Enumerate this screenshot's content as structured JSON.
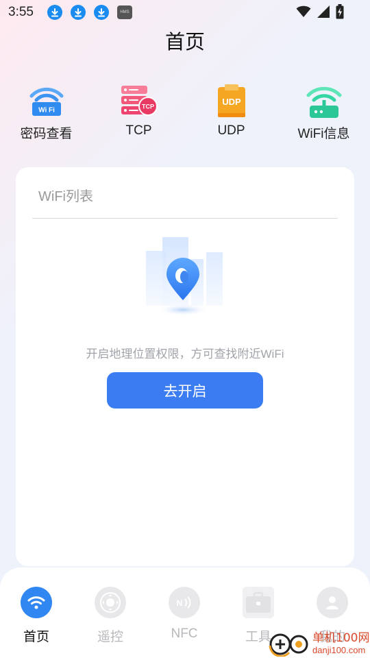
{
  "status_bar": {
    "time": "3:55",
    "hms_label": "HMS"
  },
  "page": {
    "title": "首页"
  },
  "shortcuts": [
    {
      "label": "密码查看",
      "icon": "wifi-password-icon",
      "badge": "Wi Fi"
    },
    {
      "label": "TCP",
      "icon": "tcp-server-icon",
      "badge": "TCP"
    },
    {
      "label": "UDP",
      "icon": "udp-clipboard-icon",
      "badge": "UDP"
    },
    {
      "label": "WiFi信息",
      "icon": "router-icon",
      "badge": ""
    }
  ],
  "wifi_card": {
    "header": "WiFi列表",
    "empty_message": "开启地理位置权限，方可查找附近WiFi",
    "button_label": "去开启"
  },
  "bottom_nav": {
    "items": [
      {
        "label": "首页",
        "icon": "wifi-icon",
        "active": true
      },
      {
        "label": "遥控",
        "icon": "remote-control-icon",
        "active": false
      },
      {
        "label": "NFC",
        "icon": "nfc-icon",
        "active": false
      },
      {
        "label": "工具",
        "icon": "toolbox-icon",
        "active": false
      },
      {
        "label": "我的",
        "icon": "user-icon",
        "active": false
      }
    ]
  },
  "watermark": {
    "brand": "单机100网",
    "url": "danji100.com"
  },
  "colors": {
    "accent": "#3b7cf2",
    "nav_active": "#3087f2",
    "wifi_icon_blue": "#2f8bf0",
    "tcp_red": "#f1587a",
    "udp_orange": "#f5a623",
    "router_green": "#2fd4a0"
  }
}
